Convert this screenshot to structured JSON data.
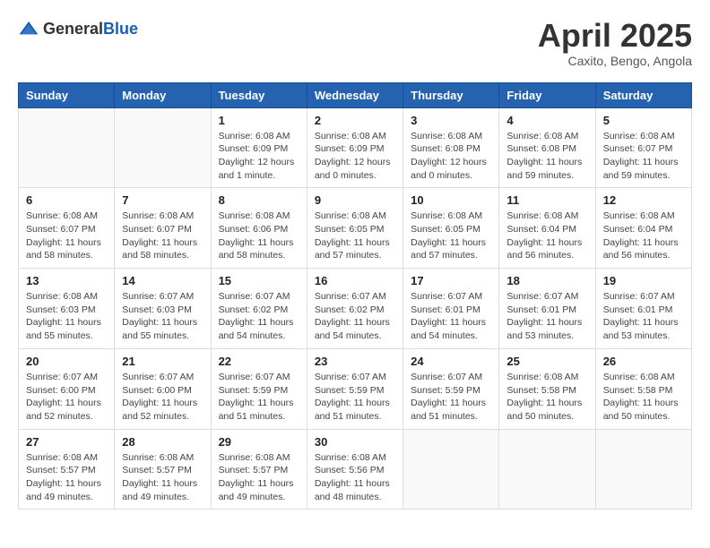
{
  "header": {
    "logo_general": "General",
    "logo_blue": "Blue",
    "title": "April 2025",
    "subtitle": "Caxito, Bengo, Angola"
  },
  "weekdays": [
    "Sunday",
    "Monday",
    "Tuesday",
    "Wednesday",
    "Thursday",
    "Friday",
    "Saturday"
  ],
  "weeks": [
    [
      {
        "day": "",
        "info": ""
      },
      {
        "day": "",
        "info": ""
      },
      {
        "day": "1",
        "info": "Sunrise: 6:08 AM\nSunset: 6:09 PM\nDaylight: 12 hours\nand 1 minute."
      },
      {
        "day": "2",
        "info": "Sunrise: 6:08 AM\nSunset: 6:09 PM\nDaylight: 12 hours\nand 0 minutes."
      },
      {
        "day": "3",
        "info": "Sunrise: 6:08 AM\nSunset: 6:08 PM\nDaylight: 12 hours\nand 0 minutes."
      },
      {
        "day": "4",
        "info": "Sunrise: 6:08 AM\nSunset: 6:08 PM\nDaylight: 11 hours\nand 59 minutes."
      },
      {
        "day": "5",
        "info": "Sunrise: 6:08 AM\nSunset: 6:07 PM\nDaylight: 11 hours\nand 59 minutes."
      }
    ],
    [
      {
        "day": "6",
        "info": "Sunrise: 6:08 AM\nSunset: 6:07 PM\nDaylight: 11 hours\nand 58 minutes."
      },
      {
        "day": "7",
        "info": "Sunrise: 6:08 AM\nSunset: 6:07 PM\nDaylight: 11 hours\nand 58 minutes."
      },
      {
        "day": "8",
        "info": "Sunrise: 6:08 AM\nSunset: 6:06 PM\nDaylight: 11 hours\nand 58 minutes."
      },
      {
        "day": "9",
        "info": "Sunrise: 6:08 AM\nSunset: 6:05 PM\nDaylight: 11 hours\nand 57 minutes."
      },
      {
        "day": "10",
        "info": "Sunrise: 6:08 AM\nSunset: 6:05 PM\nDaylight: 11 hours\nand 57 minutes."
      },
      {
        "day": "11",
        "info": "Sunrise: 6:08 AM\nSunset: 6:04 PM\nDaylight: 11 hours\nand 56 minutes."
      },
      {
        "day": "12",
        "info": "Sunrise: 6:08 AM\nSunset: 6:04 PM\nDaylight: 11 hours\nand 56 minutes."
      }
    ],
    [
      {
        "day": "13",
        "info": "Sunrise: 6:08 AM\nSunset: 6:03 PM\nDaylight: 11 hours\nand 55 minutes."
      },
      {
        "day": "14",
        "info": "Sunrise: 6:07 AM\nSunset: 6:03 PM\nDaylight: 11 hours\nand 55 minutes."
      },
      {
        "day": "15",
        "info": "Sunrise: 6:07 AM\nSunset: 6:02 PM\nDaylight: 11 hours\nand 54 minutes."
      },
      {
        "day": "16",
        "info": "Sunrise: 6:07 AM\nSunset: 6:02 PM\nDaylight: 11 hours\nand 54 minutes."
      },
      {
        "day": "17",
        "info": "Sunrise: 6:07 AM\nSunset: 6:01 PM\nDaylight: 11 hours\nand 54 minutes."
      },
      {
        "day": "18",
        "info": "Sunrise: 6:07 AM\nSunset: 6:01 PM\nDaylight: 11 hours\nand 53 minutes."
      },
      {
        "day": "19",
        "info": "Sunrise: 6:07 AM\nSunset: 6:01 PM\nDaylight: 11 hours\nand 53 minutes."
      }
    ],
    [
      {
        "day": "20",
        "info": "Sunrise: 6:07 AM\nSunset: 6:00 PM\nDaylight: 11 hours\nand 52 minutes."
      },
      {
        "day": "21",
        "info": "Sunrise: 6:07 AM\nSunset: 6:00 PM\nDaylight: 11 hours\nand 52 minutes."
      },
      {
        "day": "22",
        "info": "Sunrise: 6:07 AM\nSunset: 5:59 PM\nDaylight: 11 hours\nand 51 minutes."
      },
      {
        "day": "23",
        "info": "Sunrise: 6:07 AM\nSunset: 5:59 PM\nDaylight: 11 hours\nand 51 minutes."
      },
      {
        "day": "24",
        "info": "Sunrise: 6:07 AM\nSunset: 5:59 PM\nDaylight: 11 hours\nand 51 minutes."
      },
      {
        "day": "25",
        "info": "Sunrise: 6:08 AM\nSunset: 5:58 PM\nDaylight: 11 hours\nand 50 minutes."
      },
      {
        "day": "26",
        "info": "Sunrise: 6:08 AM\nSunset: 5:58 PM\nDaylight: 11 hours\nand 50 minutes."
      }
    ],
    [
      {
        "day": "27",
        "info": "Sunrise: 6:08 AM\nSunset: 5:57 PM\nDaylight: 11 hours\nand 49 minutes."
      },
      {
        "day": "28",
        "info": "Sunrise: 6:08 AM\nSunset: 5:57 PM\nDaylight: 11 hours\nand 49 minutes."
      },
      {
        "day": "29",
        "info": "Sunrise: 6:08 AM\nSunset: 5:57 PM\nDaylight: 11 hours\nand 49 minutes."
      },
      {
        "day": "30",
        "info": "Sunrise: 6:08 AM\nSunset: 5:56 PM\nDaylight: 11 hours\nand 48 minutes."
      },
      {
        "day": "",
        "info": ""
      },
      {
        "day": "",
        "info": ""
      },
      {
        "day": "",
        "info": ""
      }
    ]
  ]
}
